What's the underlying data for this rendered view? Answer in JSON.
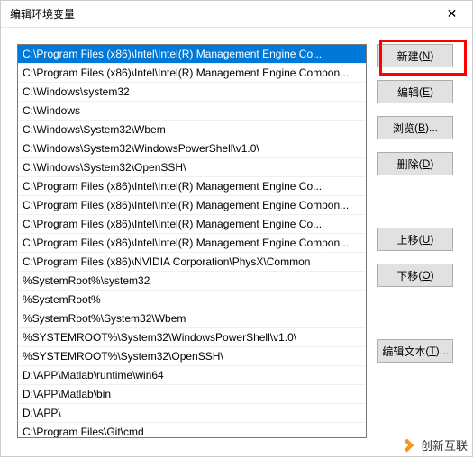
{
  "title": "编辑环境变量",
  "close_symbol": "✕",
  "list_items": [
    "C:\\Program Files (x86)\\Intel\\Intel(R) Management Engine Co...",
    "C:\\Program Files (x86)\\Intel\\Intel(R) Management Engine Compon...",
    "C:\\Windows\\system32",
    "C:\\Windows",
    "C:\\Windows\\System32\\Wbem",
    "C:\\Windows\\System32\\WindowsPowerShell\\v1.0\\",
    "C:\\Windows\\System32\\OpenSSH\\",
    "C:\\Program Files (x86)\\Intel\\Intel(R) Management Engine Co...",
    "C:\\Program Files (x86)\\Intel\\Intel(R) Management Engine Compon...",
    "C:\\Program Files (x86)\\Intel\\Intel(R) Management Engine Co...",
    "C:\\Program Files (x86)\\Intel\\Intel(R) Management Engine Compon...",
    "C:\\Program Files (x86)\\NVIDIA Corporation\\PhysX\\Common",
    "%SystemRoot%\\system32",
    "%SystemRoot%",
    "%SystemRoot%\\System32\\Wbem",
    "%SYSTEMROOT%\\System32\\WindowsPowerShell\\v1.0\\",
    "%SYSTEMROOT%\\System32\\OpenSSH\\",
    "D:\\APP\\Matlab\\runtime\\win64",
    "D:\\APP\\Matlab\\bin",
    "D:\\APP\\",
    "C:\\Program Files\\Git\\cmd"
  ],
  "selected_index": 0,
  "buttons": {
    "new": {
      "label": "新建",
      "hotkey": "N"
    },
    "edit": {
      "label": "编辑",
      "hotkey": "E"
    },
    "browse": {
      "label": "浏览",
      "hotkey": "B"
    },
    "delete": {
      "label": "删除",
      "hotkey": "D"
    },
    "moveup": {
      "label": "上移",
      "hotkey": "U"
    },
    "movedown": {
      "label": "下移",
      "hotkey": "O"
    },
    "edittext": {
      "label": "编辑文本",
      "hotkey": "T"
    }
  },
  "watermark": "创新互联"
}
